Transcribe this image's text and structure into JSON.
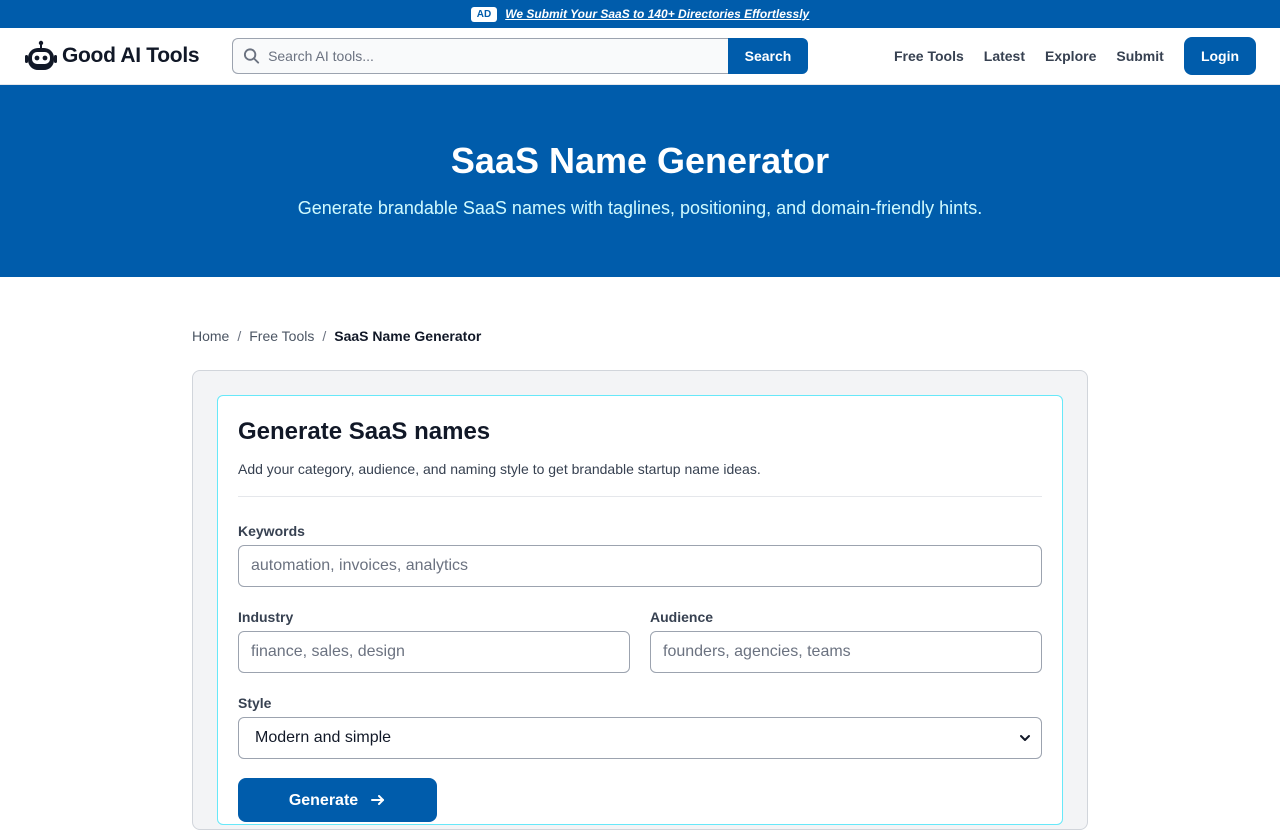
{
  "ad": {
    "badge": "AD",
    "text": "We Submit Your SaaS to 140+ Directories Effortlessly"
  },
  "header": {
    "logo_text": "Good AI Tools",
    "search": {
      "placeholder": "Search AI tools...",
      "button_label": "Search"
    },
    "nav": [
      {
        "label": "Free Tools"
      },
      {
        "label": "Latest"
      },
      {
        "label": "Explore"
      },
      {
        "label": "Submit"
      }
    ],
    "login_label": "Login"
  },
  "hero": {
    "title": "SaaS Name Generator",
    "subtitle": "Generate brandable SaaS names with taglines, positioning, and domain-friendly hints."
  },
  "breadcrumb": {
    "home": "Home",
    "parent": "Free Tools",
    "current": "SaaS Name Generator"
  },
  "form": {
    "title": "Generate SaaS names",
    "description": "Add your category, audience, and naming style to get brandable startup name ideas.",
    "keywords": {
      "label": "Keywords",
      "placeholder": "automation, invoices, analytics",
      "value": ""
    },
    "industry": {
      "label": "Industry",
      "placeholder": "finance, sales, design",
      "value": ""
    },
    "audience": {
      "label": "Audience",
      "placeholder": "founders, agencies, teams",
      "value": ""
    },
    "style": {
      "label": "Style",
      "selected": "Modern and simple"
    },
    "generate_label": "Generate"
  },
  "colors": {
    "brand": "#005cab",
    "hero_subtitle": "#cffafe",
    "card_border": "#67e8f9"
  }
}
